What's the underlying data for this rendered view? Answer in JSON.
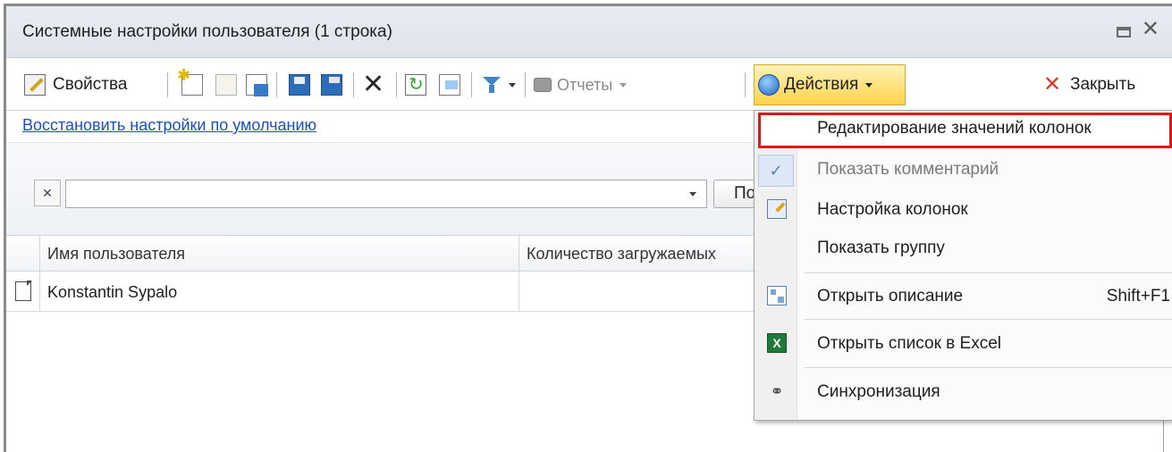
{
  "window": {
    "title": "Системные настройки пользователя (1 строка)",
    "icons": {
      "maximize": "restore-icon",
      "close": "close-icon"
    }
  },
  "toolbar": {
    "properties_label": "Свойства",
    "reports_label": "Отчеты",
    "actions_label": "Действия",
    "close_label": "Закрыть",
    "icons": [
      "properties-icon",
      "new-icon",
      "folder-icon",
      "copy-icon",
      "save-icon",
      "save-all-icon",
      "delete-icon",
      "refresh-icon",
      "export-icon",
      "filter-icon",
      "print-icon",
      "actions-icon",
      "close-x-icon"
    ],
    "actions_highlight_color": "#ffd24a",
    "close_icon_color": "#d83b2a"
  },
  "link": {
    "restore_defaults": "Восстановить настройки по умолчанию"
  },
  "filter": {
    "search_value": "",
    "find_button_label": "По"
  },
  "grid": {
    "columns": [
      "Имя пользователя",
      "Количество загружаемых"
    ],
    "rows": [
      {
        "user_name": "Konstantin Sypalo",
        "count": ""
      }
    ]
  },
  "actions_menu": {
    "items": [
      {
        "label": "Редактирование значений колонок",
        "highlighted": true
      },
      {
        "label": "Показать комментарий",
        "disabled": true,
        "checked": true
      },
      {
        "label": "Настройка колонок",
        "icon": "columns-settings-icon"
      },
      {
        "label": "Показать группу"
      },
      {
        "label": "Открыть описание",
        "shortcut": "Shift+F1",
        "icon": "description-icon"
      },
      {
        "label": "Открыть список в Excel",
        "icon": "excel-icon"
      },
      {
        "label": "Синхронизация",
        "icon": "sync-icon"
      }
    ],
    "highlight_color": "#e01717"
  }
}
